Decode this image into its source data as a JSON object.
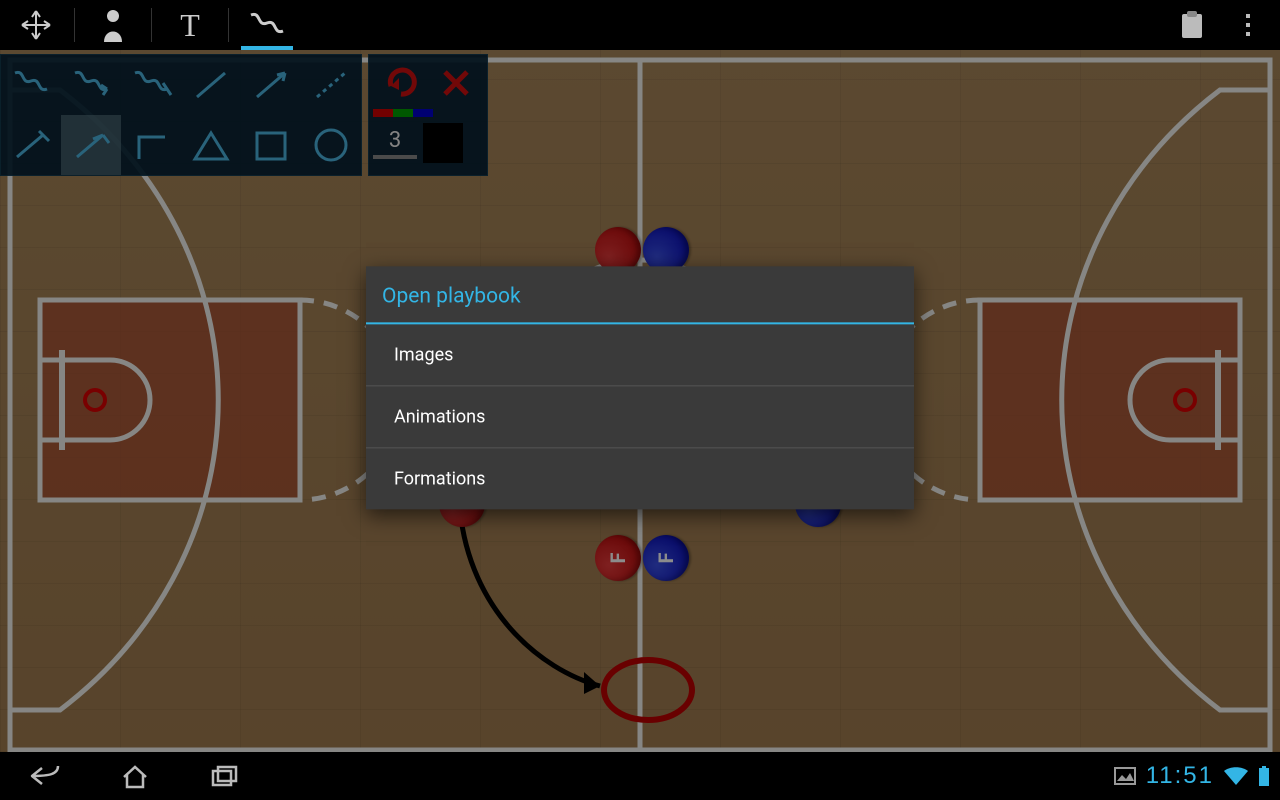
{
  "actionbar": {
    "tools": [
      "move",
      "player",
      "text",
      "draw"
    ],
    "selected": "draw"
  },
  "palette": {
    "stroke_width": "3",
    "colors": [
      "#d00000",
      "#00a000",
      "#0000d0"
    ]
  },
  "dialog": {
    "title": "Open playbook",
    "items": [
      "Images",
      "Animations",
      "Formations"
    ]
  },
  "players": {
    "f_label": "F"
  },
  "status": {
    "time": "11:51"
  }
}
